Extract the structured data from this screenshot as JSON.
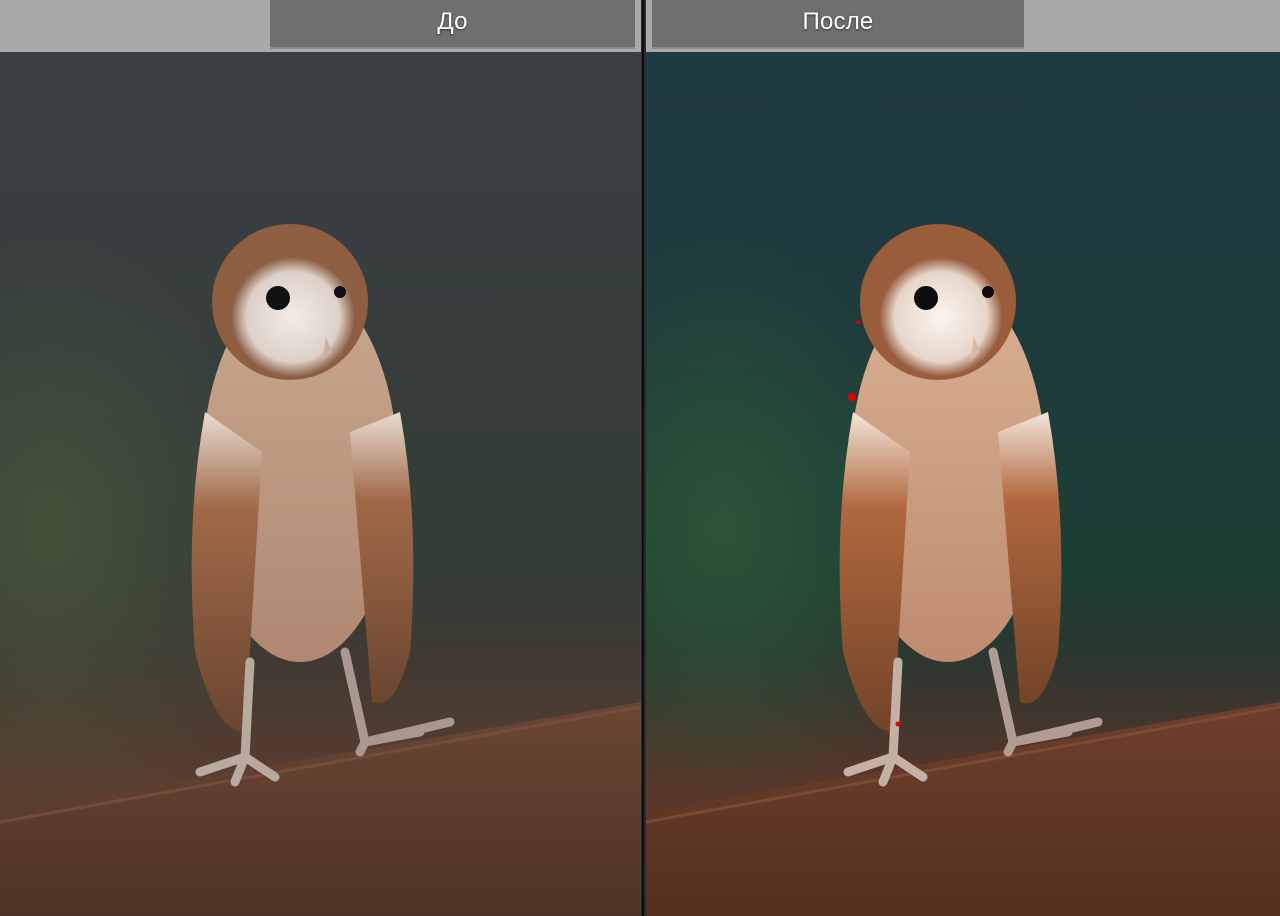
{
  "view": {
    "mode": "before-after-side-by-side",
    "before_label": "До",
    "after_label": "После"
  },
  "photo": {
    "subject": "owl",
    "before_tone": {
      "background_top": "#3c4044",
      "background_mid": "#34403a",
      "ground": "#5a3b2e"
    },
    "after_tone": {
      "background_top": "#1f3a42",
      "background_mid": "#1e4034",
      "ground": "#5f3527"
    }
  }
}
